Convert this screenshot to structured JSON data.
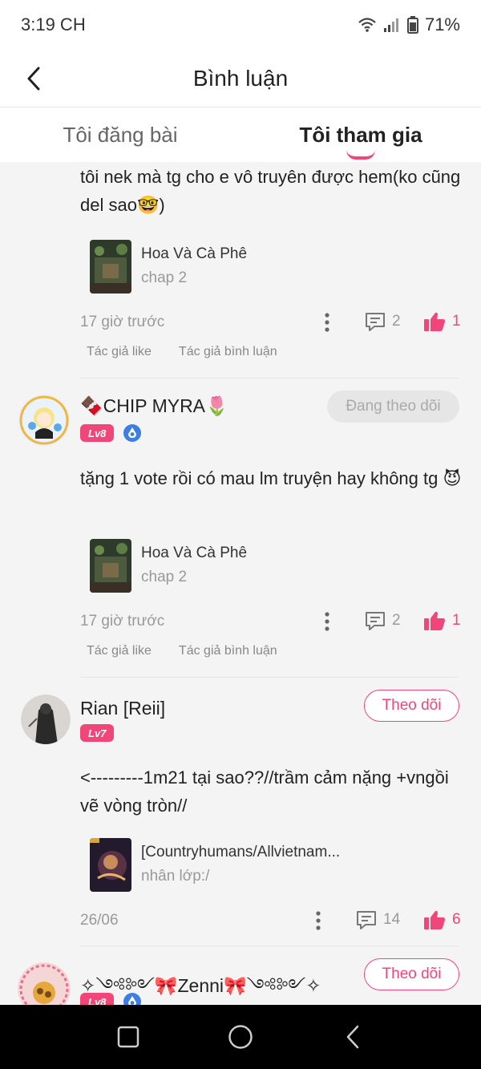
{
  "status_bar": {
    "time": "3:19 CH",
    "battery": "71%"
  },
  "header": {
    "title": "Bình luận"
  },
  "tabs": [
    {
      "label": "Tôi đăng bài"
    },
    {
      "label": "Tôi tham gia",
      "active": true
    }
  ],
  "colors": {
    "accent": "#f0467a",
    "muted": "#999999",
    "background": "#f4f4f4"
  },
  "icons": [
    "back-icon",
    "wifi-icon",
    "signal-icon",
    "battery-icon",
    "more-icon",
    "reply-icon",
    "like-icon",
    "vip-badge-icon"
  ],
  "comments": [
    {
      "text": "tôi nek mà tg cho e vô truyên được hem(ko cũng del sao🤓)",
      "story": {
        "title": "Hoa Và Cà Phê",
        "chapter": "chap 2"
      },
      "time": "17 giờ trước",
      "replies": "2",
      "likes": "1",
      "tags": [
        "Tác giả like",
        "Tác giả bình luận"
      ]
    },
    {
      "user": "🍫CHIP MYRA🌷",
      "level": "Lv8",
      "follow": "Đang theo dõi",
      "text": "tặng 1 vote rồi có mau lm truyện hay không tg 😈",
      "story": {
        "title": "Hoa Và Cà Phê",
        "chapter": "chap 2"
      },
      "time": "17 giờ trước",
      "replies": "2",
      "likes": "1",
      "tags": [
        "Tác giả like",
        "Tác giả bình luận"
      ]
    },
    {
      "user": "Rian [Reii]",
      "level": "Lv7",
      "follow": "Theo dõi",
      "text": "<---------1m21 tại sao??//trầm cảm nặng +vngồi vẽ vòng tròn//",
      "story": {
        "title": "[Countryhumans/Allvietnam...",
        "chapter": "nhân lớp:/"
      },
      "time": "26/06",
      "replies": "14",
      "likes": "6"
    },
    {
      "user": "✧༺༻🎀Zenni🎀༺༻✧",
      "level": "Lv8",
      "follow": "Theo dõi"
    }
  ]
}
